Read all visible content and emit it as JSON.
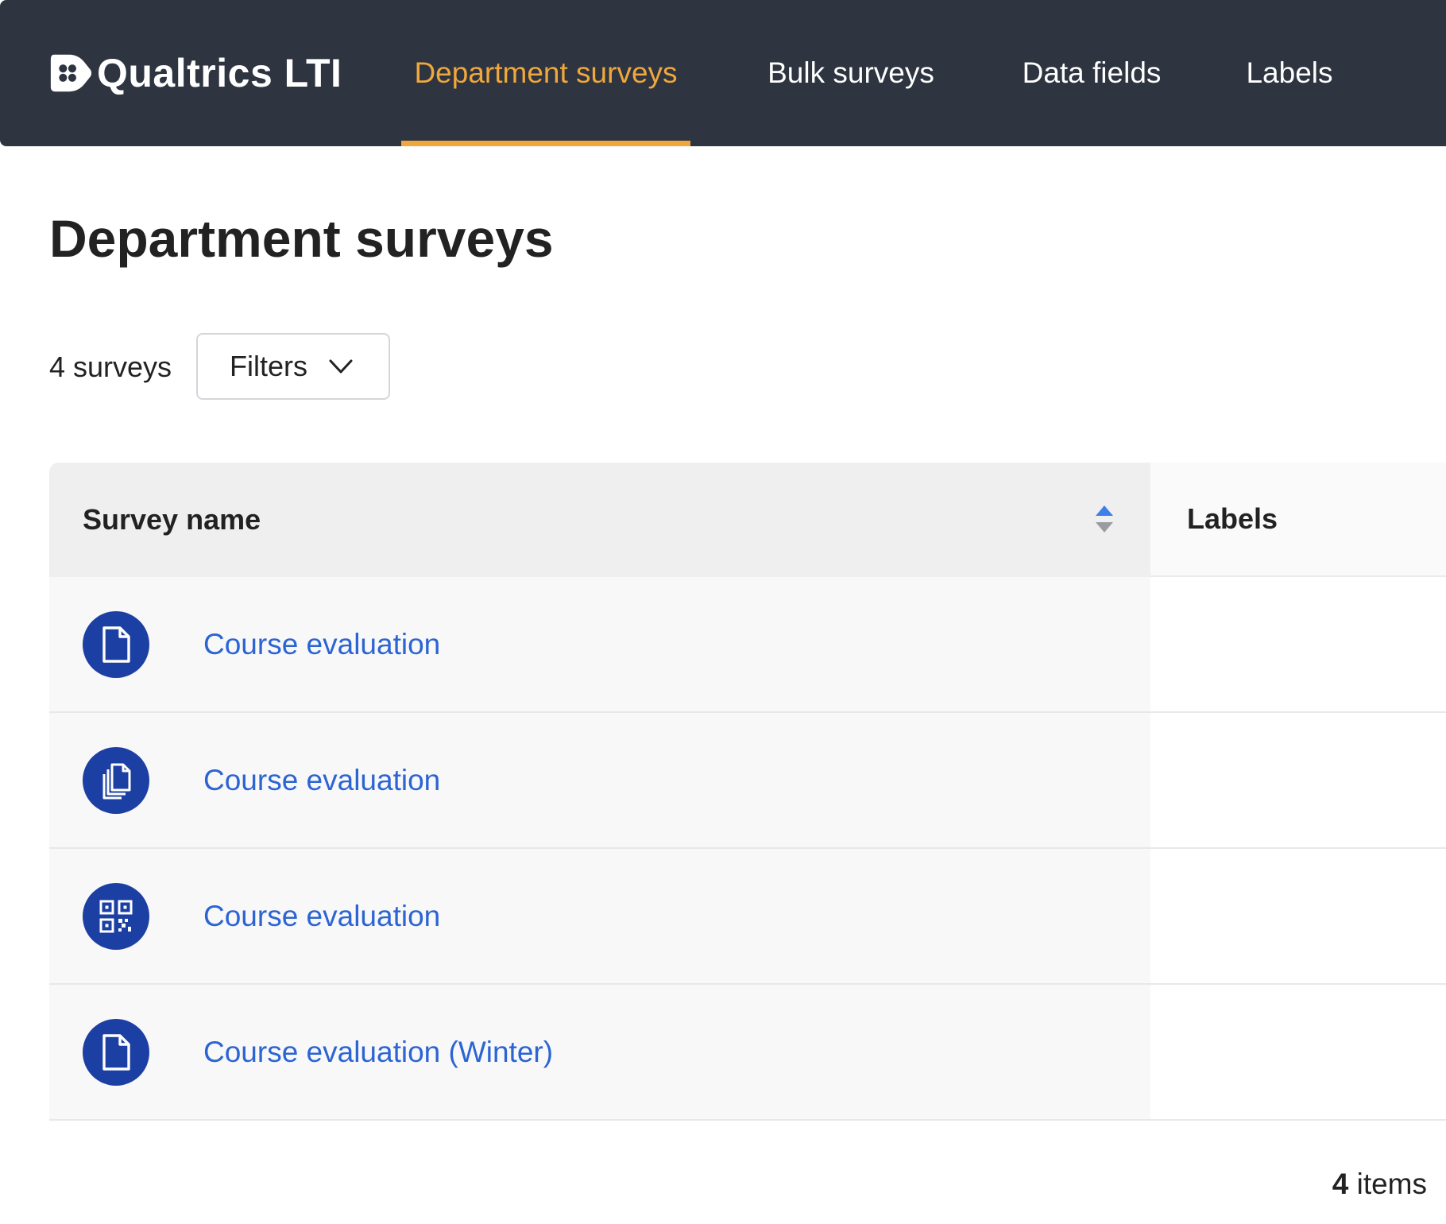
{
  "app": {
    "logo_text": "Qualtrics LTI"
  },
  "nav": {
    "tabs": [
      {
        "label": "Department surveys",
        "active": true
      },
      {
        "label": "Bulk surveys",
        "active": false
      },
      {
        "label": "Data fields",
        "active": false
      },
      {
        "label": "Labels",
        "active": false
      }
    ]
  },
  "page": {
    "title": "Department surveys"
  },
  "toolbar": {
    "count_label": "4 surveys",
    "filters_label": "Filters"
  },
  "table": {
    "columns": {
      "name": "Survey name",
      "labels": "Labels"
    },
    "rows": [
      {
        "icon": "document-icon",
        "name": "Course evaluation",
        "labels": ""
      },
      {
        "icon": "copy-documents-icon",
        "name": "Course evaluation",
        "labels": ""
      },
      {
        "icon": "qr-code-icon",
        "name": "Course evaluation",
        "labels": ""
      },
      {
        "icon": "document-icon",
        "name": "Course evaluation (Winter)",
        "labels": ""
      }
    ]
  },
  "footer": {
    "items_number": "4",
    "items_suffix": " items"
  },
  "colors": {
    "nav_bg": "#2e3440",
    "accent": "#f0a73c",
    "icon_bg": "#1c3fa3",
    "link": "#2c64d4",
    "sort_active": "#3f7ee8"
  }
}
